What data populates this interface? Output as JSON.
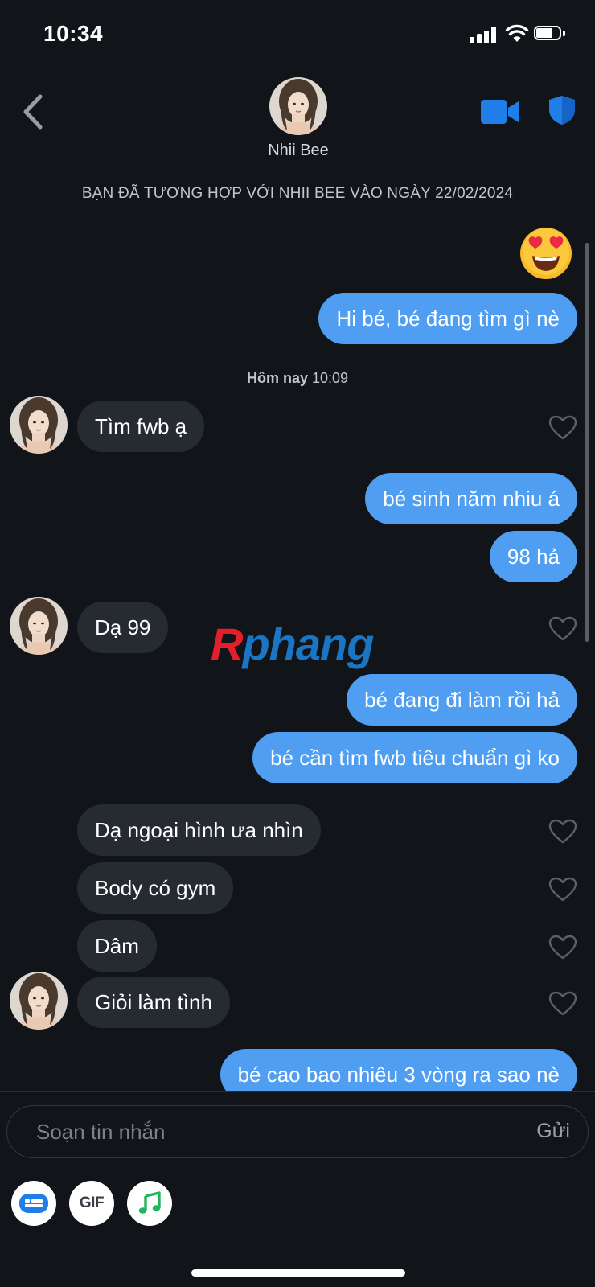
{
  "status_bar": {
    "time": "10:34"
  },
  "header": {
    "name": "Nhii Bee"
  },
  "match_text": "BẠN ĐÃ TƯƠNG HỢP VỚI NHII BEE VÀO NGÀY 22/02/2024",
  "timestamp": {
    "day": "Hôm nay",
    "time": "10:09"
  },
  "messages": {
    "m1": "Hi bé, bé đang tìm gì nè",
    "m2": "Tìm fwb ạ",
    "m3": "bé sinh năm nhiu á",
    "m4": "98 hả",
    "m5": "Dạ 99",
    "m6": "bé đang đi làm rồi hả",
    "m7": "bé cần tìm fwb tiêu chuẩn gì ko",
    "m8": "Dạ ngoại hình ưa nhìn",
    "m9": "Body có gym",
    "m10": "Dâm",
    "m11": "Giỏi làm tình",
    "m12": "bé cao bao nhiêu 3 vòng ra sao nè"
  },
  "watermark": {
    "first": "R",
    "rest": "phang"
  },
  "composer": {
    "placeholder": "Soạn tin nhắn",
    "send": "Gửi"
  },
  "toolbar": {
    "gif": "GIF"
  },
  "colors": {
    "outgoing": "#4f9ef1",
    "incoming": "#262a31",
    "accent": "#1f7ee8"
  }
}
